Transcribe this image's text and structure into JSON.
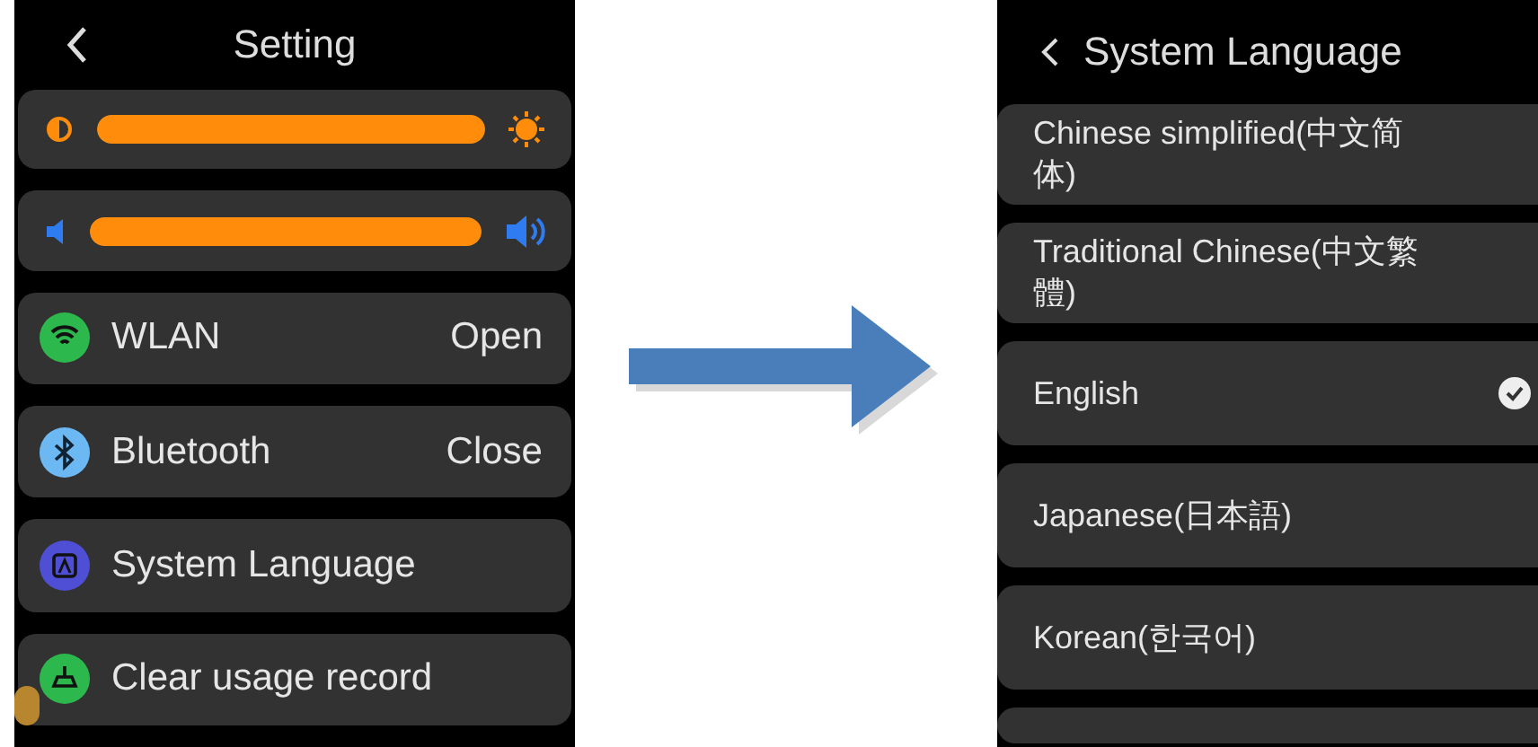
{
  "settings_screen": {
    "title": "Setting",
    "sliders": [
      {
        "kind": "brightness",
        "level": 1
      },
      {
        "kind": "volume",
        "level": 1
      }
    ],
    "items": [
      {
        "kind": "wifi",
        "label": "WLAN",
        "value": "Open"
      },
      {
        "kind": "bluetooth",
        "label": "Bluetooth",
        "value": "Close"
      },
      {
        "kind": "language",
        "label": "System Language"
      },
      {
        "kind": "clear",
        "label": "Clear usage record"
      }
    ]
  },
  "language_screen": {
    "title": "System Language",
    "languages": [
      {
        "label": "Chinese simplified(中文简体)",
        "selected": false
      },
      {
        "label": "Traditional Chinese(中文繁體)",
        "selected": false
      },
      {
        "label": "English",
        "selected": true
      },
      {
        "label": "Japanese(日本語)",
        "selected": false
      },
      {
        "label": "Korean(한국어)",
        "selected": false
      }
    ]
  }
}
